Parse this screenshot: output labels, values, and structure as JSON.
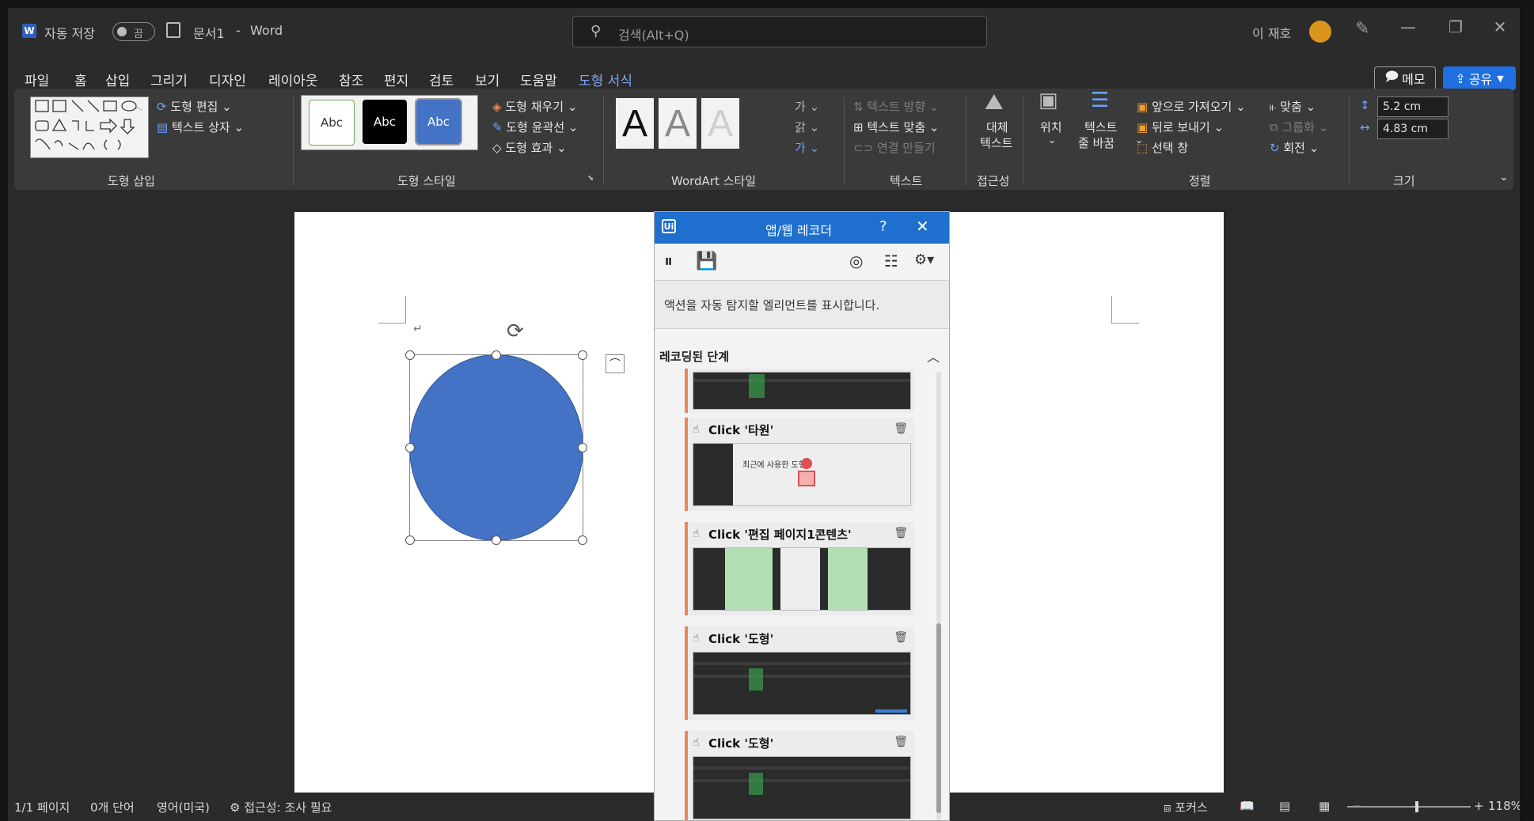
{
  "titlebar": {
    "app_letter": "W",
    "autosave_label": "자동 저장",
    "autosave_state": "끔",
    "doc_title": "문서1",
    "separator": "-",
    "app_name": "Word",
    "search_placeholder": "검색(Alt+Q)",
    "user_name": "이 재호"
  },
  "menu": {
    "items": [
      "파일",
      "홈",
      "삽입",
      "그리기",
      "디자인",
      "레이아웃",
      "참조",
      "편지",
      "검토",
      "보기",
      "도움말",
      "도형 서식"
    ],
    "active": "도형 서식",
    "memo_label": "메모",
    "share_label": "공유"
  },
  "ribbon": {
    "insert_shapes": {
      "edit_shape": "도형 편집",
      "text_box": "텍스트 상자",
      "label": "도형 삽입"
    },
    "shape_styles": {
      "samples": [
        "Abc",
        "Abc",
        "Abc"
      ],
      "fill": "도형 채우기",
      "outline": "도형 윤곽선",
      "effects": "도형 효과",
      "label": "도형 스타일"
    },
    "wordart": {
      "samples": [
        "A",
        "A",
        "A"
      ],
      "label": "WordArt 스타일"
    },
    "text": {
      "direction": "텍스트 방향",
      "align": "텍스트 맞춤",
      "link": "연결 만들기",
      "label": "텍스트"
    },
    "accessibility": {
      "alt_text_1": "대체",
      "alt_text_2": "텍스트",
      "label": "접근성"
    },
    "arrange": {
      "position": "위치",
      "wrap_1": "텍스트",
      "wrap_2": "줄 바꿈",
      "bring_forward": "앞으로 가져오기",
      "send_backward": "뒤로 보내기",
      "selection_pane": "선택 창",
      "align": "맞춤",
      "group": "그룹화",
      "rotate": "회전",
      "label": "정렬"
    },
    "size": {
      "height": "5.2 cm",
      "width": "4.83 cm",
      "label": "크기"
    }
  },
  "recorder": {
    "title": "앱/웹 레코더",
    "help": "?",
    "hint": "액션을 자동 탐지할 엘리먼트를 표시합니다.",
    "section_title": "레코딩된 단계",
    "steps": [
      {
        "label": "Click '타원'"
      },
      {
        "label": "Click '편집 페이지1콘텐츠'"
      },
      {
        "label": "Click '도형'"
      },
      {
        "label": "Click '도형'"
      }
    ],
    "thumb_text_recent": "최근에 사용한 도형"
  },
  "statusbar": {
    "page": "1/1 페이지",
    "words": "0개 단어",
    "language": "영어(미국)",
    "accessibility": "접근성: 조사 필요",
    "focus": "포커스",
    "zoom_minus": "−",
    "zoom_plus": "+",
    "zoom": "118%"
  }
}
